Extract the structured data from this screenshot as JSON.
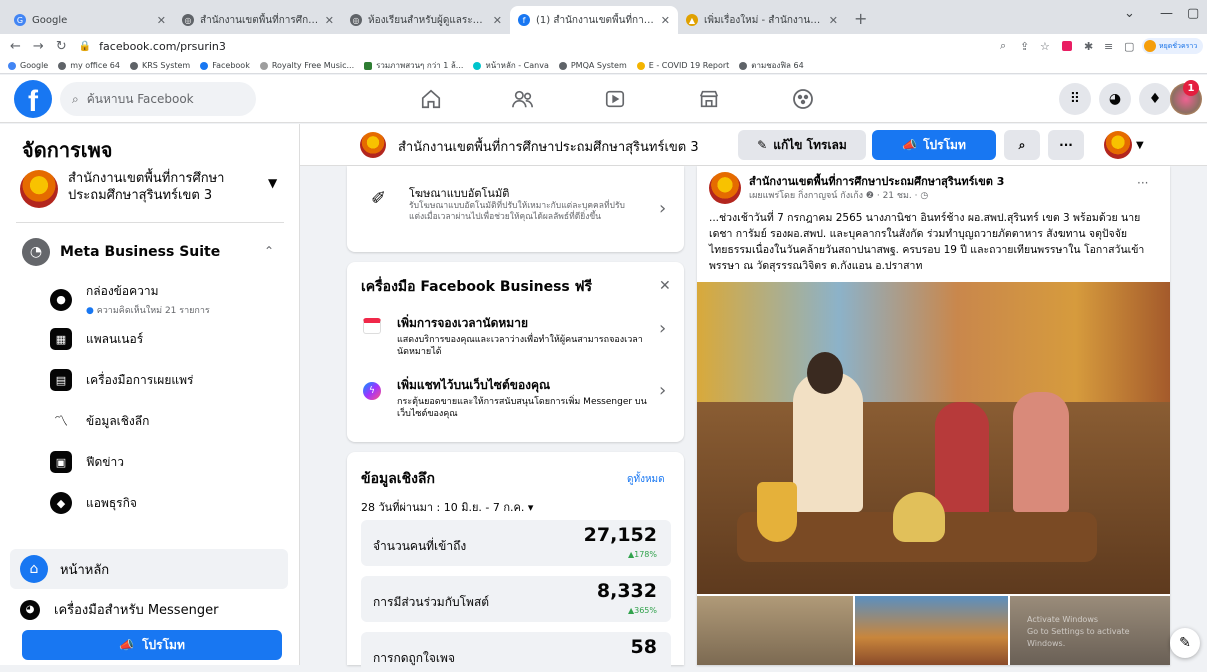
{
  "browser": {
    "tabs": [
      {
        "title": "Google",
        "active": false
      },
      {
        "title": "สำนักงานเขตพื้นที่การศึกษาประถมศึ",
        "active": false
      },
      {
        "title": "ห้องเรียนสำหรับผู้ดูแลระบบแพ",
        "active": false
      },
      {
        "title": "(1) สำนักงานเขตพื้นที่การศึกษาประ",
        "active": true
      },
      {
        "title": "เพิ่มเรื่องใหม่ - สำนักงานเขตพื้นที่การ",
        "active": false
      }
    ],
    "url": "facebook.com/prsurin3",
    "bookmarks": [
      "Google",
      "my office 64",
      "KRS System",
      "Facebook",
      "Royalty Free Music...",
      "รวมภาพสวนๆ กว่า 1 ล้...",
      "หน้าหลัก - Canva",
      "PMQA System",
      "E - COVID 19 Report",
      "ตามชองฟิล 64"
    ],
    "profile_label": "หยุดชั่วคราว"
  },
  "fb": {
    "search_placeholder": "ค้นหาบน Facebook",
    "notification_count": "1"
  },
  "sidebar": {
    "title": "จัดการเพจ",
    "page_name": "สำนักงานเขตพื้นที่การศึกษาประถมศึกษาสุรินทร์เขต 3",
    "suite_label": "Meta Business Suite",
    "items": [
      {
        "label": "กล่องข้อความ",
        "sub": "ความคิดเห็นใหม่ 21 รายการ"
      },
      {
        "label": "แพลนเนอร์"
      },
      {
        "label": "เครื่องมือการเผยแพร่"
      },
      {
        "label": "ข้อมูลเชิงลึก"
      },
      {
        "label": "ฟีดข่าว"
      },
      {
        "label": "แอพธุรกิจ"
      }
    ],
    "home_label": "หน้าหลัก",
    "messenger_label": "เครื่องมือสำหรับ Messenger",
    "promote_label": "โปรโมท"
  },
  "pagebar": {
    "page_name": "สำนักงานเขตพื้นที่การศึกษาประถมศึกษาสุรินทร์เขต 3",
    "edit_label": "แก้ไข โทรเลม",
    "promote_label": "โปรโมท"
  },
  "ads_card": {
    "title": "โฆษณาแบบอัตโนมัติ",
    "desc": "รับโฆษณาแบบอัตโนมัติที่ปรับให้เหมาะกับแต่ละบุคคลที่ปรับแต่งเมื่อเวลาผ่านไปเพื่อช่วยให้คุณได้ผลลัพธ์ที่ดียิ่งขึ้น"
  },
  "tools_card": {
    "title": "เครื่องมือ Facebook Business ฟรี",
    "items": [
      {
        "title": "เพิ่มการจองเวลานัดหมาย",
        "desc": "แสดงบริการของคุณและเวลาว่างเพื่อทำให้ผู้คนสามารถจองเวลานัดหมายได้"
      },
      {
        "title": "เพิ่มแชทไว้บนเว็บไซต์ของคุณ",
        "desc": "กระตุ้นยอดขายและให้การสนับสนุนโดยการเพิ่ม Messenger บนเว็บไซต์ของคุณ"
      }
    ]
  },
  "insights_card": {
    "title": "ข้อมูลเชิงลึก",
    "see_all": "ดูทั้งหมด",
    "range": "28 วันที่ผ่านมา : 10 มิ.ย. - 7 ก.ค. ▾",
    "stats": [
      {
        "label": "จำนวนคนที่เข้าถึง",
        "value": "27,152",
        "change": "▲178%"
      },
      {
        "label": "การมีส่วนร่วมกับโพสต์",
        "value": "8,332",
        "change": "▲365%"
      },
      {
        "label": "การกดถูกใจเพจ",
        "value": "58",
        "change": ""
      }
    ]
  },
  "post": {
    "author": "สำนักงานเขตพื้นที่การศึกษาประถมศึกษาสุรินทร์เขต 3",
    "meta": "เผยแพร่โดย กิ่งกาญจน์ กังเก้ง ❷ · 21 ชม. · ◷",
    "text": "...ช่วงเช้าวันที่ 7 กรกฎาคม 2565 นางภานิชา อินทร์ช้าง ผอ.สพป.สุรินทร์ เขต 3 พร้อมด้วย นายเดชา การัมย์ รองผอ.สพป. และบุคลากรในสังกัด ร่วมทำบุญถวายภัตตาหาร สังฆทาน จตุปัจจัยไทยธรรมเนื่องในวันคล้ายวันสถาปนาสพฐ. ครบรอบ 19 ปี และถวายเทียนพรรษาใน โอกาสวันเข้าพรรษา ณ วัดสุรรรณวิจิตร ต.กังแอน อ.ปราสาท",
    "watermark": "Activate Windows\nGo to Settings to activate Windows."
  }
}
